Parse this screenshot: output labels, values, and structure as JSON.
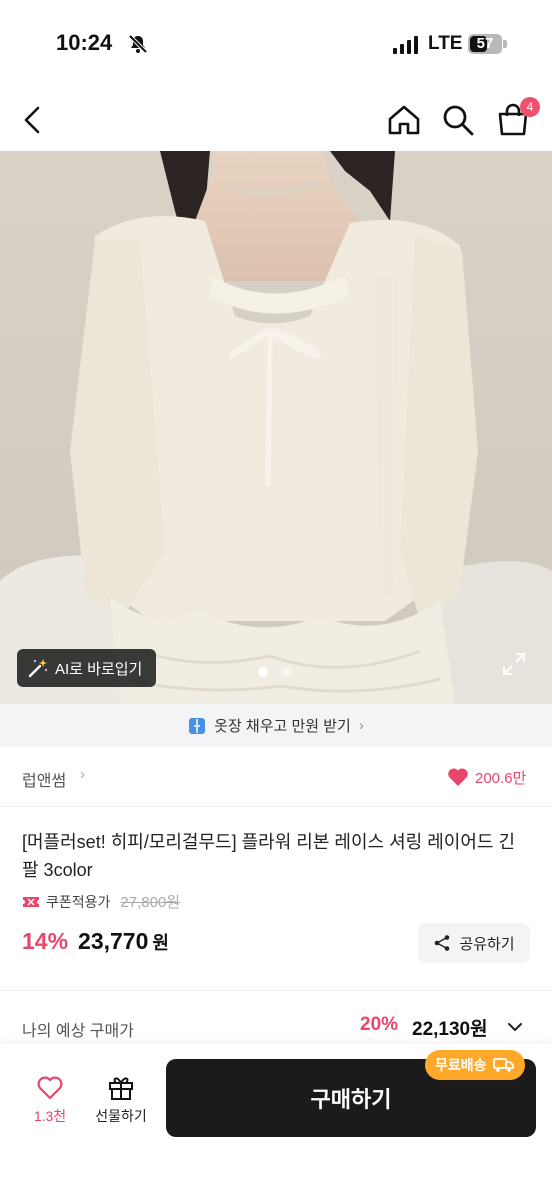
{
  "status_bar": {
    "time": "10:24",
    "network": "LTE",
    "battery": "57",
    "battery_level": 0.57
  },
  "nav": {
    "back_icon": "chevron-left-icon",
    "home_icon": "home-icon",
    "search_icon": "search-icon",
    "cart_icon": "shopping-bag-icon",
    "cart_count": "4"
  },
  "hero": {
    "ai_button_label": "AI로 바로입기",
    "page_count": 2,
    "active_page": 1
  },
  "promo_banner": {
    "text": "옷장 채우고 만원 받기",
    "chevron": "›"
  },
  "seller": {
    "name": "럽앤썸",
    "chevron": "›",
    "likes": "200.6만"
  },
  "product": {
    "title": "[머플러set! 히피/모리걸무드] 플라워 리본 레이스 셔링 레이어드 긴팔 3color",
    "coupon_label": "쿠폰적용가",
    "original_price": "27,800원",
    "discount": "14%",
    "price": "23,770",
    "currency": "원",
    "share_label": "공유하기"
  },
  "expected_price": {
    "label": "나의 예상 구매가",
    "discount": "20%",
    "amount": "22,130원"
  },
  "bottom_bar": {
    "like_count": "1.3천",
    "gift_label": "선물하기",
    "buy_label": "구매하기",
    "free_shipping_label": "무료배송"
  },
  "colors": {
    "accent": "#e8466a",
    "buy_button": "#1b1b1b",
    "free_shipping": "#ffa92a",
    "promo_bg": "#f3f4f6"
  }
}
